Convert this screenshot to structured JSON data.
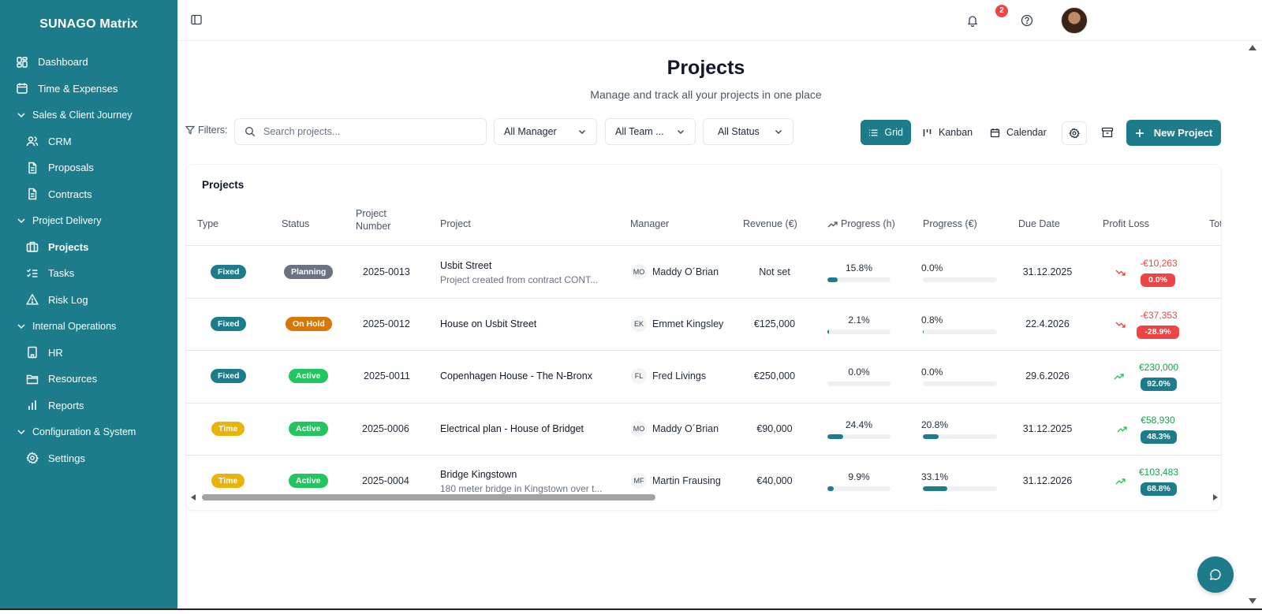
{
  "app": {
    "title": "SUNAGO Matrix"
  },
  "colors": {
    "primary": "#1c7c8c",
    "danger": "#ef4444",
    "success": "#22c55e",
    "warning": "#d97706",
    "time": "#eab308",
    "neutral": "#6b7280"
  },
  "sidebar": {
    "items": [
      {
        "label": "Dashboard",
        "icon": "dashboard-icon"
      },
      {
        "label": "Time & Expenses",
        "icon": "calendar-icon"
      },
      {
        "label": "Sales & Client Journey",
        "icon": "chevron-down-icon"
      },
      {
        "label": "CRM",
        "icon": "users-icon"
      },
      {
        "label": "Proposals",
        "icon": "file-icon"
      },
      {
        "label": "Contracts",
        "icon": "file-icon"
      },
      {
        "label": "Project Delivery",
        "icon": "chevron-down-icon"
      },
      {
        "label": "Projects",
        "icon": "briefcase-icon"
      },
      {
        "label": "Tasks",
        "icon": "checklist-icon"
      },
      {
        "label": "Risk Log",
        "icon": "warning-icon"
      },
      {
        "label": "Internal Operations",
        "icon": "chevron-down-icon"
      },
      {
        "label": "HR",
        "icon": "building-icon"
      },
      {
        "label": "Resources",
        "icon": "folder-icon"
      },
      {
        "label": "Reports",
        "icon": "bar-chart-icon"
      },
      {
        "label": "Configuration & System",
        "icon": "chevron-down-icon"
      },
      {
        "label": "Settings",
        "icon": "gear-icon"
      }
    ]
  },
  "topbar": {
    "notification_count": "2"
  },
  "header": {
    "title": "Projects",
    "subtitle": "Manage and track all your projects in one place"
  },
  "filters": {
    "label": "Filters:",
    "search_placeholder": "Search projects...",
    "manager": "All Manager",
    "team": "All Team ...",
    "status": "All Status"
  },
  "views": {
    "grid": "Grid",
    "kanban": "Kanban",
    "calendar": "Calendar"
  },
  "actions": {
    "new_project": "New Project"
  },
  "table": {
    "title": "Projects",
    "columns": {
      "type": "Type",
      "status": "Status",
      "project_number_1": "Project",
      "project_number_2": "Number",
      "project": "Project",
      "manager": "Manager",
      "revenue": "Revenue (€)",
      "progress_h": "Progress (h)",
      "progress_eur": "Progress (€)",
      "due_date": "Due Date",
      "profit_loss": "Profit Loss",
      "total": "Tot"
    },
    "rows": [
      {
        "type": "Fixed",
        "status": "Planning",
        "number": "2025-0013",
        "name": "Usbit Street",
        "desc": "Project created from contract CONT...",
        "initials": "MO",
        "manager": "Maddy O´Brian",
        "revenue": "Not set",
        "prog_h": "15.8%",
        "prog_h_val": 15.8,
        "prog_e": "0.0%",
        "prog_e_val": 0.0,
        "due": "31.12.2025",
        "pl_amount": "-€10,263",
        "pl_pct": "0.0%"
      },
      {
        "type": "Fixed",
        "status": "On Hold",
        "number": "2025-0012",
        "name": "House on Usbit Street",
        "desc": "",
        "initials": "EK",
        "manager": "Emmet Kingsley",
        "revenue": "€125,000",
        "prog_h": "2.1%",
        "prog_h_val": 2.1,
        "prog_e": "0.8%",
        "prog_e_val": 0.8,
        "due": "22.4.2026",
        "pl_amount": "-€37,353",
        "pl_pct": "-28.9%"
      },
      {
        "type": "Fixed",
        "status": "Active",
        "number": "2025-0011",
        "name": "Copenhagen House - The N-Bronx",
        "desc": "",
        "initials": "FL",
        "manager": "Fred Livings",
        "revenue": "€250,000",
        "prog_h": "0.0%",
        "prog_h_val": 0.0,
        "prog_e": "0.0%",
        "prog_e_val": 0.0,
        "due": "29.6.2026",
        "pl_amount": "€230,000",
        "pl_pct": "92.0%"
      },
      {
        "type": "Time",
        "status": "Active",
        "number": "2025-0006",
        "name": "Electrical plan - House of Bridget",
        "desc": "",
        "initials": "MO",
        "manager": "Maddy O´Brian",
        "revenue": "€90,000",
        "prog_h": "24.4%",
        "prog_h_val": 24.4,
        "prog_e": "20.8%",
        "prog_e_val": 20.8,
        "due": "31.12.2025",
        "pl_amount": "€58,930",
        "pl_pct": "48.3%"
      },
      {
        "type": "Time",
        "status": "Active",
        "number": "2025-0004",
        "name": "Bridge Kingstown",
        "desc": "180 meter bridge in Kingstown over t...",
        "initials": "MF",
        "manager": "Martin Frausing",
        "revenue": "€40,000",
        "prog_h": "9.9%",
        "prog_h_val": 9.9,
        "prog_e": "33.1%",
        "prog_e_val": 33.1,
        "due": "31.12.2026",
        "pl_amount": "€103,483",
        "pl_pct": "68.8%"
      }
    ]
  }
}
